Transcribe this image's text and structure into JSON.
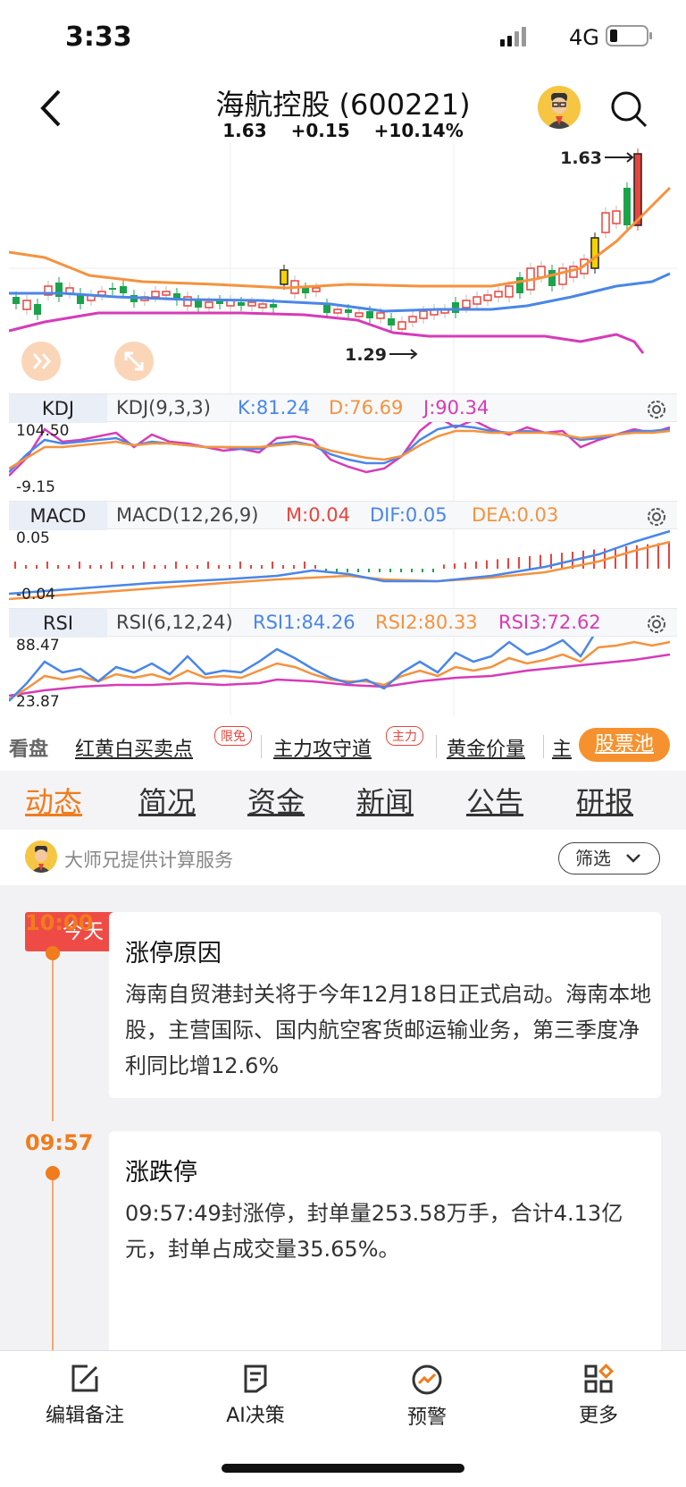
{
  "status_bar": {
    "time": "3:33",
    "network": "4G"
  },
  "header": {
    "title": "海航控股 (600221)",
    "price": "1.63",
    "change": "+0.15",
    "change_pct": "+10.14%"
  },
  "kline": {
    "high_label": "1.63",
    "low_label": "1.29"
  },
  "kdj": {
    "tag": "KDJ",
    "params": "KDJ(9,3,3)",
    "k": "K:81.24",
    "d": "D:76.69",
    "j": "J:90.34",
    "axis_top": "104.50",
    "axis_bottom": "-9.15"
  },
  "macd": {
    "tag": "MACD",
    "params": "MACD(12,26,9)",
    "m": "M:0.04",
    "dif": "DIF:0.05",
    "dea": "DEA:0.03",
    "axis_top": "0.05",
    "axis_bottom": "-0.04"
  },
  "rsi": {
    "tag": "RSI",
    "params": "RSI(6,12,24)",
    "rsi1": "RSI1:84.26",
    "rsi2": "RSI2:80.33",
    "rsi3": "RSI3:72.62",
    "axis_top": "88.47",
    "axis_bottom": "23.87"
  },
  "strip": {
    "fixed": "看盘",
    "links": [
      "红黄白买卖点",
      "主力攻守道",
      "黄金价量",
      "主"
    ],
    "badges": [
      "限免",
      "主力"
    ],
    "pool": "股票池"
  },
  "tabs": [
    "动态",
    "简况",
    "资金",
    "新闻",
    "公告",
    "研报"
  ],
  "service": {
    "text": "大师兄提供计算服务",
    "filter": "筛选"
  },
  "feed": {
    "today": "今天",
    "items": [
      {
        "time": "10:00",
        "title": "涨停原因",
        "body": "海南自贸港封关将于今年12月18日正式启动。海南本地股，主营国际、国内航空客货邮运输业务，第三季度净利同比增12.6%"
      },
      {
        "time": "09:57",
        "title": "涨跌停",
        "body": "09:57:49封涨停，封单量253.58万手，合计4.13亿元，封单占成交量35.65%。"
      }
    ]
  },
  "bottom_nav": [
    "编辑备注",
    "AI决策",
    "预警",
    "更多"
  ],
  "colors": {
    "up": "#e8453c",
    "down": "#1aa34a",
    "accent": "#f07c1c",
    "blue": "#4a86e8",
    "orange": "#f5923e",
    "magenta": "#d63bb8"
  }
}
